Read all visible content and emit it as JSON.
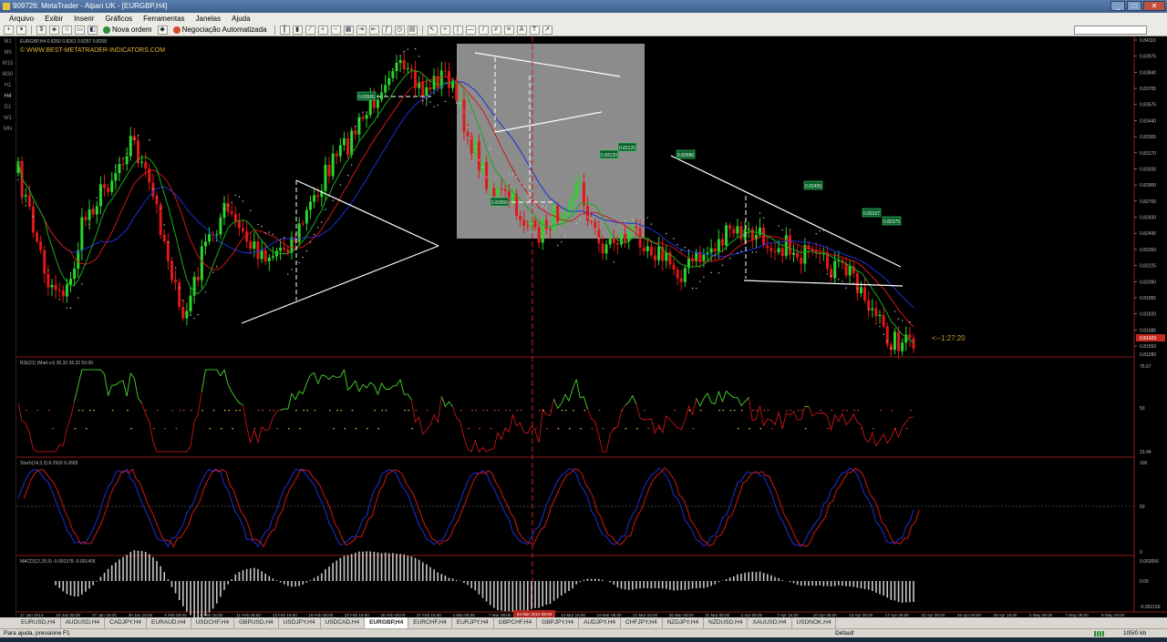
{
  "window": {
    "title": "909726: MetaTrader - Alpari UK - [EURGBP,H4]",
    "buttons": [
      "_",
      "□",
      "✕"
    ]
  },
  "menu": [
    "Arquivo",
    "Exibir",
    "Inserir",
    "Gráficos",
    "Ferramentas",
    "Janelas",
    "Ajuda"
  ],
  "toolbar": {
    "new_order": "Nova ordem",
    "autotrading": "Negociação Automatizada"
  },
  "timeframes": [
    "M1",
    "M5",
    "M15",
    "M30",
    "H1",
    "H4",
    "D1",
    "W1",
    "MN"
  ],
  "timeframe_active": "H4",
  "colors": {
    "bull": "#2bd52b",
    "bear": "#e01818",
    "ma1": "#1e2fd8",
    "ma2": "#d01818",
    "ma3": "#1ea81e",
    "trend": "#ffffff",
    "shade": "#8c8c8c",
    "vline": "#cc1a1a",
    "watermark": "#e3b23a",
    "separator": "#8b1a1a",
    "axis": "#bbbbbb"
  },
  "main": {
    "info": "EURGBP,H4 0.8260 0.8261 0.8257 0.8258",
    "watermark": "© WWW.BEST-METATRADER-INDICATORS.COM",
    "countdown": "<--1:27:20",
    "price_labels": [
      "0.84110",
      "0.83975",
      "0.83840",
      "0.83705",
      "0.83575",
      "0.83440",
      "0.83305",
      "0.83170",
      "0.83035",
      "0.82900",
      "0.82765",
      "0.82630",
      "0.82495",
      "0.82360",
      "0.82225",
      "0.82090",
      "0.81955",
      "0.81820",
      "0.81685",
      "0.81550"
    ],
    "current_price": "0.81429",
    "bottom_price": "0.81280",
    "level_tags": [
      "0.83565",
      "0.82855",
      "0.83125",
      "0.83120",
      "0.82986",
      "0.82455",
      "0.82337",
      "0.82375"
    ]
  },
  "rsi": {
    "info": "RSI(21) (Mart.v.t) 36.32 36.32 50.00",
    "levels": [
      "75.57",
      "50",
      "23.94"
    ]
  },
  "stoch": {
    "info": "Stoch(14,3,3) 8.2918 9.2683",
    "levels": [
      "100",
      "50",
      "0"
    ]
  },
  "macd": {
    "info": "MACD(12,26,9) -0.001378 -0.001405",
    "levels": [
      "0.002656",
      "0.00",
      "-0.002169"
    ]
  },
  "time_labels": [
    "17 Jan 2014",
    "22 Jan 08:00",
    "27 Jan 16:00",
    "30 Jan 16:00",
    "4 Feb 08:00",
    "6 Feb 16:00",
    "11 Feb 08:00",
    "13 Feb 16:00",
    "18 Feb 08:00",
    "20 Feb 16:00",
    "25 Feb 08:00",
    "27 Feb 16:00",
    "4 Mar 08:00",
    "7 Mar 08:00",
    "11 Mar 16:00",
    "14 Mar 16:00",
    "19 Mar 08:00",
    "21 Mar 16:00",
    "26 Mar 08:00",
    "31 Mar 08:00",
    "2 Apr 08:00",
    "7 Apr 16:00",
    "10 Apr 08:00",
    "15 Apr 00:00",
    "17 Apr 08:00",
    "22 Apr 00:00",
    "25 Apr 00:00",
    "29 Apr 16:00",
    "2 May 08:00",
    "7 May 08:00",
    "9 May 16:00"
  ],
  "cursor_time": "24 Mar 2014 08:00",
  "symbol_tabs": [
    "EURUSD,H4",
    "AUDUSD,H4",
    "CADJPY,H4",
    "EURAUD,H4",
    "USDCHF,H4",
    "GBPUSD,H4",
    "USDJPY,H4",
    "USDCAD,H4",
    "EURGBP,H4",
    "EURCHF,H4",
    "EURJPY,H4",
    "GBPCHF,H4",
    "GBPJPY,H4",
    "AUDJPY,H4",
    "CHFJPY,H4",
    "NZDJPY,H4",
    "NZDUSD,H4",
    "XAUUSD,H4",
    "USDNOK,H4"
  ],
  "active_tab": "EURGBP,H4",
  "status": {
    "help": "Para ajuda, pressione F1",
    "profile": "Default",
    "traffic": "105/0 kb"
  }
}
